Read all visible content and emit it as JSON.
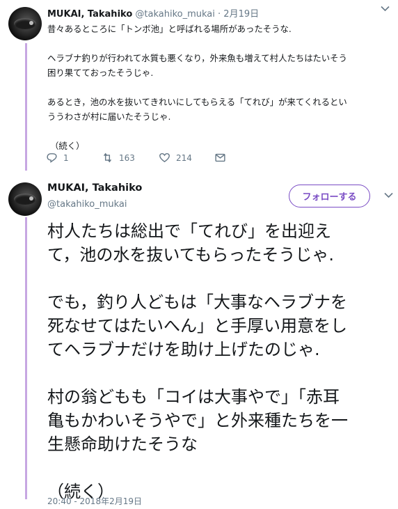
{
  "tweet1": {
    "name": "MUKAI, Takahiko",
    "handle": "@takahiko_mukai",
    "separator": "·",
    "date": "2月19日",
    "paragraphs": [
      [
        "昔々あるところに「トンボ池」と呼ばれる場所があったそうな."
      ],
      [
        "ヘラブナ釣りが行われて水質も悪くなり，外来魚も増えて村人たちはたいそう",
        "困り果てておったそうじゃ."
      ],
      [
        "あるとき，池の水を抜いてきれいにしてもらえる「てれび」が来てくれるとい",
        "ううわさが村に届いたそうじゃ."
      ],
      [
        "（続く）"
      ]
    ],
    "actions": {
      "reply_count": "1",
      "retweet_count": "163",
      "like_count": "214"
    }
  },
  "tweet2": {
    "name": "MUKAI, Takahiko",
    "handle": "@takahiko_mukai",
    "follow_label": "フォローする",
    "paragraphs": [
      [
        "村人たちは総出で「てれび」を出迎え",
        "て，池の水を抜いてもらったそうじゃ."
      ],
      [
        "でも，釣り人どもは「大事なヘラブナを",
        "死なせてはたいへん」と手厚い用意をし",
        "てヘラブナだけを助け上げたのじゃ."
      ],
      [
        "村の翁どもも「コイは大事やで」「赤耳",
        "亀もかわいそうやで」と外来種たちを一",
        "生懸命助けたそうな"
      ],
      [
        "（続く）"
      ]
    ],
    "timestamp": "20:40 - 2018年2月19日"
  },
  "icons": {
    "more": "chevron-down-icon",
    "reply": "reply-icon",
    "retweet": "retweet-icon",
    "like": "heart-icon",
    "dm": "envelope-icon"
  },
  "colors": {
    "accent": "#794bc4",
    "thread_line": "#c7a7e2",
    "secondary_text": "#657786",
    "primary_text": "#14171a"
  }
}
